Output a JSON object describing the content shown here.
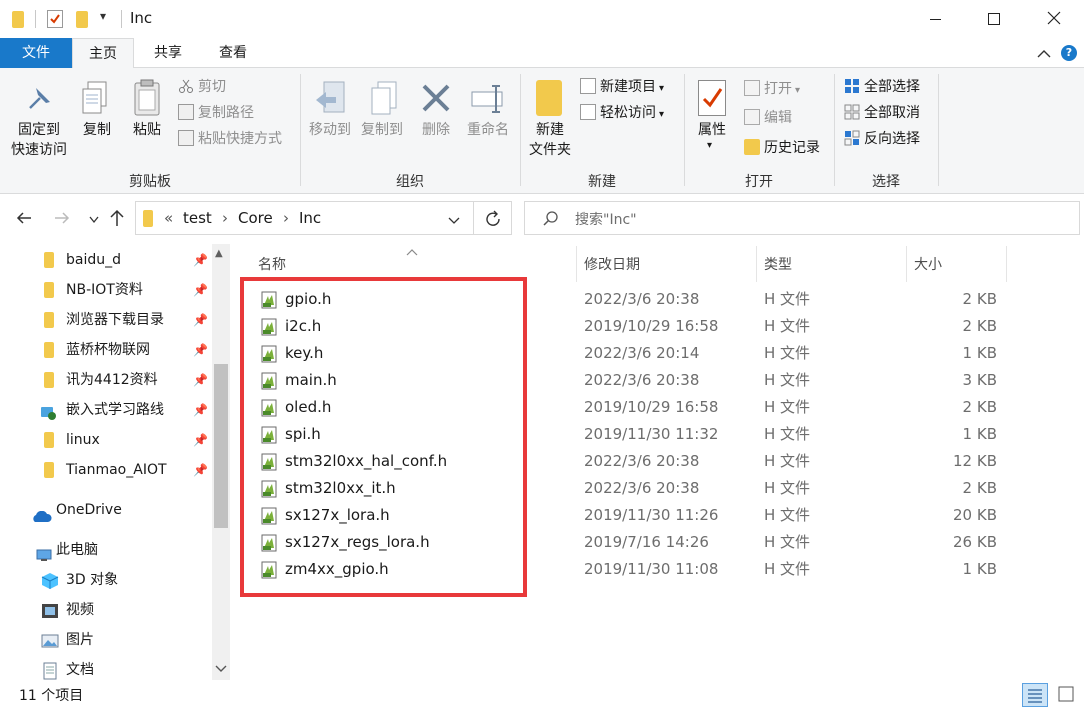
{
  "window": {
    "title": "Inc",
    "qat_dropdown": "▾"
  },
  "ribbon_tabs": [
    "文件",
    "主页",
    "共享",
    "查看"
  ],
  "ribbon": {
    "clipboard": {
      "pin_label": "固定到\n快速访问",
      "copy_label": "复制",
      "paste_label": "粘贴",
      "cut_label": "剪切",
      "copy_path_label": "复制路径",
      "paste_shortcut_label": "粘贴快捷方式",
      "group_label": "剪贴板"
    },
    "organize": {
      "move_to_label": "移动到",
      "copy_to_label": "复制到",
      "delete_label": "删除",
      "rename_label": "重命名",
      "group_label": "组织"
    },
    "new": {
      "new_folder_label": "新建\n文件夹",
      "new_item_label": "新建项目",
      "easy_access_label": "轻松访问",
      "group_label": "新建"
    },
    "open": {
      "properties_label": "属性",
      "open_label": "打开",
      "edit_label": "编辑",
      "history_label": "历史记录",
      "group_label": "打开"
    },
    "select": {
      "select_all_label": "全部选择",
      "select_none_label": "全部取消",
      "invert_label": "反向选择",
      "group_label": "选择"
    }
  },
  "address": {
    "overflow": "«",
    "crumbs": [
      "test",
      "Core",
      "Inc"
    ],
    "search_placeholder": "搜索\"Inc\""
  },
  "nav": {
    "quick_access": [
      {
        "label": "baidu_d",
        "icon": "folder-icon",
        "pinned": true
      },
      {
        "label": "NB-IOT资料",
        "icon": "folder-icon",
        "pinned": true
      },
      {
        "label": "浏览器下载目录",
        "icon": "folder-icon",
        "pinned": true
      },
      {
        "label": "蓝桥杯物联网",
        "icon": "folder-icon",
        "pinned": true
      },
      {
        "label": "讯为4412资料",
        "icon": "folder-icon",
        "pinned": true
      },
      {
        "label": "嵌入式学习路线",
        "icon": "network-folder-icon",
        "pinned": true
      },
      {
        "label": "linux",
        "icon": "folder-icon",
        "pinned": true
      },
      {
        "label": "Tianmao_AIOT",
        "icon": "folder-icon",
        "pinned": true
      }
    ],
    "onedrive": "OneDrive",
    "this_pc": "此电脑",
    "pc_items": [
      {
        "label": "3D 对象",
        "icon": "3d-objects-icon"
      },
      {
        "label": "视频",
        "icon": "video-icon"
      },
      {
        "label": "图片",
        "icon": "pictures-icon"
      },
      {
        "label": "文档",
        "icon": "documents-icon"
      }
    ]
  },
  "columns": {
    "name": "名称",
    "date": "修改日期",
    "type": "类型",
    "size": "大小"
  },
  "files": [
    {
      "name": "gpio.h",
      "date": "2022/3/6 20:38",
      "type": "H 文件",
      "size": "2 KB"
    },
    {
      "name": "i2c.h",
      "date": "2019/10/29 16:58",
      "type": "H 文件",
      "size": "2 KB"
    },
    {
      "name": "key.h",
      "date": "2022/3/6 20:14",
      "type": "H 文件",
      "size": "1 KB"
    },
    {
      "name": "main.h",
      "date": "2022/3/6 20:38",
      "type": "H 文件",
      "size": "3 KB"
    },
    {
      "name": "oled.h",
      "date": "2019/10/29 16:58",
      "type": "H 文件",
      "size": "2 KB"
    },
    {
      "name": "spi.h",
      "date": "2019/11/30 11:32",
      "type": "H 文件",
      "size": "1 KB"
    },
    {
      "name": "stm32l0xx_hal_conf.h",
      "date": "2022/3/6 20:38",
      "type": "H 文件",
      "size": "12 KB"
    },
    {
      "name": "stm32l0xx_it.h",
      "date": "2022/3/6 20:38",
      "type": "H 文件",
      "size": "2 KB"
    },
    {
      "name": "sx127x_lora.h",
      "date": "2019/11/30 11:26",
      "type": "H 文件",
      "size": "20 KB"
    },
    {
      "name": "sx127x_regs_lora.h",
      "date": "2019/7/16 14:26",
      "type": "H 文件",
      "size": "26 KB"
    },
    {
      "name": "zm4xx_gpio.h",
      "date": "2019/11/30 11:08",
      "type": "H 文件",
      "size": "1 KB"
    }
  ],
  "status": {
    "item_count": "11 个项目"
  },
  "colors": {
    "file_tab_bg": "#1979ca",
    "highlight_box": "#e8393a",
    "folder": "#f2c94c"
  }
}
